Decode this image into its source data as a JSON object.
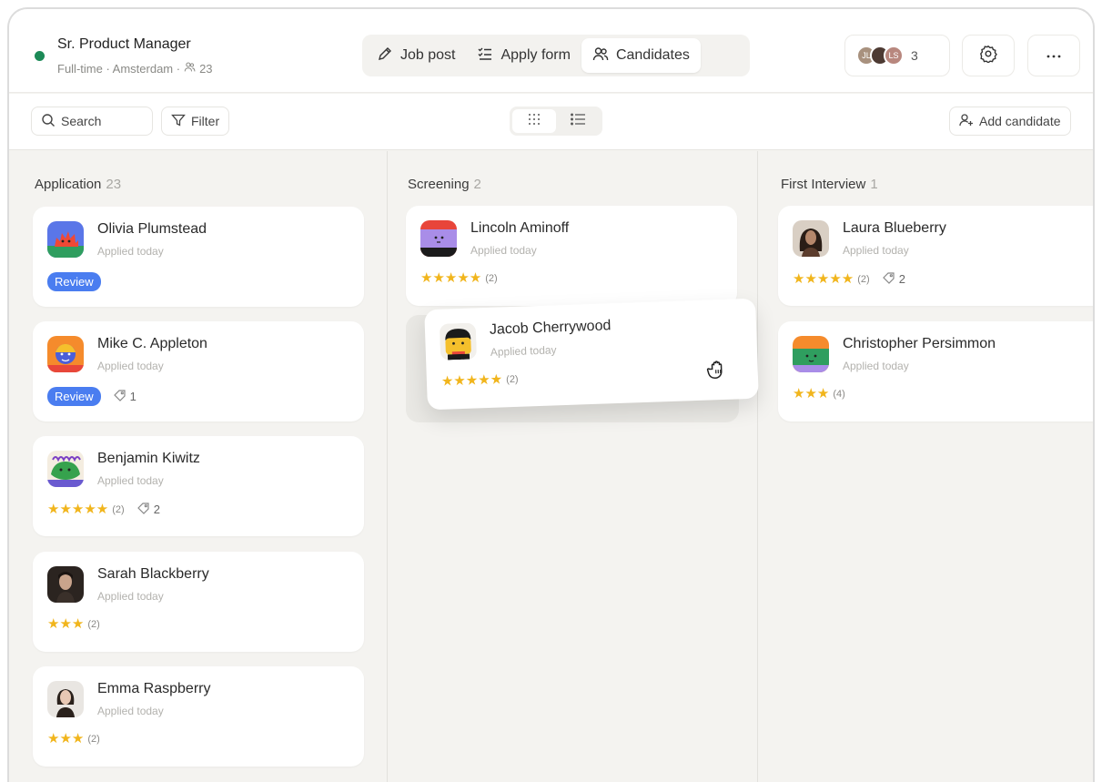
{
  "job": {
    "title": "Sr. Product Manager",
    "meta": "Full-time · Amsterdam ·",
    "candidate_count": "23"
  },
  "tabs": [
    {
      "label": "Job post",
      "icon": "pencil-icon"
    },
    {
      "label": "Apply form",
      "icon": "checklist-icon"
    },
    {
      "label": "Candidates",
      "icon": "users-icon",
      "active": true
    }
  ],
  "team": {
    "avatars": [
      "JL",
      "",
      "LS"
    ],
    "count": "3"
  },
  "toolbar": {
    "search_label": "Search",
    "filter_label": "Filter",
    "add_candidate_label": "Add candidate"
  },
  "colors": {
    "accent_blue": "#4a7df0",
    "star": "#f1b51c",
    "status_green": "#1c8a57"
  },
  "columns": [
    {
      "title": "Application",
      "count": "23",
      "cards": [
        {
          "name": "Olivia Plumstead",
          "sub": "Applied today",
          "badge": "Review"
        },
        {
          "name": "Mike C. Appleton",
          "sub": "Applied today",
          "badge": "Review",
          "tags": "1"
        },
        {
          "name": "Benjamin Kiwitz",
          "sub": "Applied today",
          "stars": 5,
          "rating_count": "(2)",
          "tags": "2"
        },
        {
          "name": "Sarah Blackberry",
          "sub": "Applied today",
          "stars": 3,
          "rating_count": "(2)"
        },
        {
          "name": "Emma Raspberry",
          "sub": "Applied today",
          "stars": 3,
          "rating_count": "(2)"
        }
      ]
    },
    {
      "title": "Screening",
      "count": "2",
      "cards": [
        {
          "name": "Lincoln Aminoff",
          "sub": "Applied today",
          "stars": 5,
          "rating_count": "(2)"
        },
        {
          "name": "Jacob Cherrywood",
          "sub": "Applied today",
          "stars": 5,
          "rating_count": "(2)",
          "dragging": true
        }
      ]
    },
    {
      "title": "First Interview",
      "count": "1",
      "cards": [
        {
          "name": "Laura Blueberry",
          "sub": "Applied today",
          "stars": 5,
          "rating_count": "(2)",
          "tags": "2"
        },
        {
          "name": "Christopher Persimmon",
          "sub": "Applied today",
          "stars": 3,
          "rating_count": "(4)"
        }
      ]
    }
  ]
}
